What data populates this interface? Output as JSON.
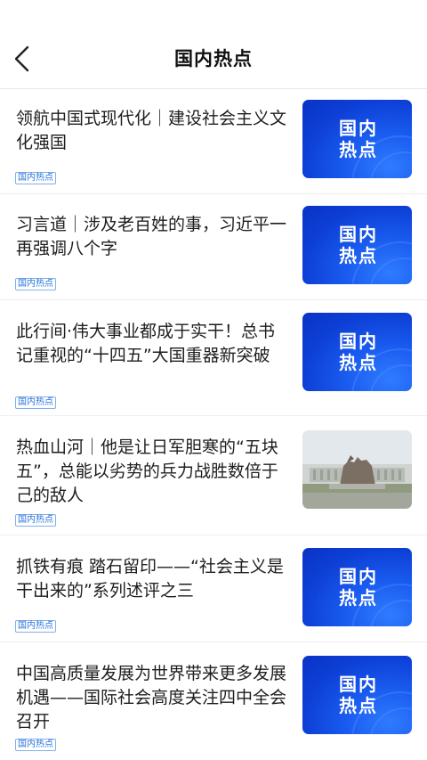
{
  "header": {
    "title": "国内热点",
    "back_icon": "chevron-left-icon"
  },
  "colors": {
    "tag": "#2a76d8",
    "thumb_blue": "#1a5cf0"
  },
  "items": [
    {
      "title": "领航中国式现代化｜建设社会主义文化强国",
      "tag": "国内热点",
      "thumb_text": "国内热点"
    },
    {
      "title": "习言道｜涉及老百姓的事，习近平一再强调八个字",
      "tag": "国内热点",
      "thumb_text": "国内热点"
    },
    {
      "title": "此行间·伟大事业都成于实干！总书记重视的“十四五”大国重器新突破",
      "tag": "国内热点",
      "thumb_text": "国内热点"
    },
    {
      "title": "热血山河｜他是让日军胆寒的“五块五”，总能以劣势的兵力战胜数倍于己的敌人",
      "tag": "国内热点",
      "thumb_text": ""
    },
    {
      "title": "抓铁有痕  踏石留印——“社会主义是干出来的”系列述评之三",
      "tag": "国内热点",
      "thumb_text": "国内热点"
    },
    {
      "title": "中国高质量发展为世界带来更多发展机遇——国际社会高度关注四中全会召开",
      "tag": "国内热点",
      "thumb_text": "国内热点"
    }
  ]
}
